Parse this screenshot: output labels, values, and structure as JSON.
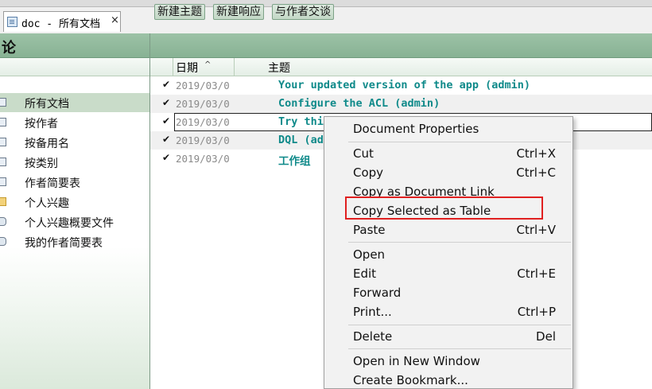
{
  "tab": {
    "title": "doc - 所有文档",
    "close": "×",
    "icon": "document-icon"
  },
  "nav": {
    "title": "论",
    "items": [
      {
        "label": "所有文档",
        "icon": "view-icon",
        "selected": true
      },
      {
        "label": "按作者",
        "icon": "view-icon"
      },
      {
        "label": "按备用名",
        "icon": "view-icon"
      },
      {
        "label": "按类别",
        "icon": "view-icon"
      },
      {
        "label": "作者简要表",
        "icon": "view-icon"
      },
      {
        "label": "个人兴趣",
        "icon": "folder-icon"
      },
      {
        "label": "个人兴趣概要文件",
        "icon": "person-icon"
      },
      {
        "label": "我的作者简要表",
        "icon": "person-icon"
      }
    ]
  },
  "actions": {
    "new_topic": "新建主题",
    "new_response": "新建响应",
    "talk_author": "与作者交谈"
  },
  "columns": {
    "date": "日期",
    "sort": "^",
    "subject": "主题"
  },
  "rows": [
    {
      "check": "✔",
      "date": "2019/03/0",
      "subject": "Your updated version of the app (admin)"
    },
    {
      "check": "✔",
      "date": "2019/03/0",
      "subject": "Configure the ACL (admin)"
    },
    {
      "check": "✔",
      "date": "2019/03/0",
      "subject": "Try thi"
    },
    {
      "check": "✔",
      "date": "2019/03/0",
      "subject": "DQL (ad"
    },
    {
      "check": "✔",
      "date": "2019/03/0",
      "subject": "工作组"
    }
  ],
  "menu": {
    "document_properties": "Document Properties",
    "cut": "Cut",
    "cut_key": "Ctrl+X",
    "copy": "Copy",
    "copy_key": "Ctrl+C",
    "copy_doclink": "Copy as Document Link",
    "copy_table": "Copy Selected as Table",
    "paste": "Paste",
    "paste_key": "Ctrl+V",
    "open": "Open",
    "edit": "Edit",
    "edit_key": "Ctrl+E",
    "forward": "Forward",
    "print": "Print...",
    "print_key": "Ctrl+P",
    "delete": "Delete",
    "delete_key": "Del",
    "open_new_window": "Open in New Window",
    "create_bookmark": "Create Bookmark..."
  },
  "colors": {
    "accent_green": "#88b294",
    "subject_teal": "#0f8a8a",
    "highlight_red": "#e02020"
  }
}
